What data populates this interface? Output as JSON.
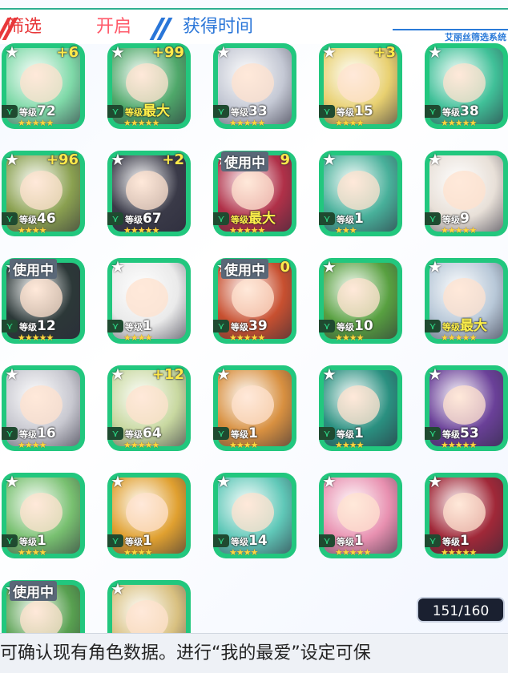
{
  "header": {
    "tabs": [
      {
        "label": "筛选",
        "color": "#e8383a"
      },
      {
        "label": "开启",
        "color": "#ff5a6a"
      },
      {
        "label": "获得时间",
        "color": "#2a76d8"
      }
    ],
    "brand": "艾丽丝筛选系统"
  },
  "cards": [
    {
      "plus": "+6",
      "level_label": "等级",
      "level": "72",
      "stars": 5,
      "in_use": "",
      "theme": "#7fd9a8"
    },
    {
      "plus": "+99",
      "level_label": "等级",
      "level": "最大",
      "stars": 5,
      "in_use": "",
      "theme": "#4fa86a"
    },
    {
      "plus": "",
      "level_label": "等级",
      "level": "33",
      "stars": 5,
      "in_use": "",
      "theme": "#c4c8d4"
    },
    {
      "plus": "+3",
      "level_label": "等级",
      "level": "15",
      "stars": 4,
      "in_use": "",
      "theme": "#e8d070"
    },
    {
      "plus": "",
      "level_label": "等级",
      "level": "38",
      "stars": 5,
      "in_use": "",
      "theme": "#40c098"
    },
    {
      "plus": "+96",
      "level_label": "等级",
      "level": "46",
      "stars": 4,
      "in_use": "",
      "theme": "#8aa050"
    },
    {
      "plus": "+2",
      "level_label": "等级",
      "level": "67",
      "stars": 5,
      "in_use": "",
      "theme": "#3a3a48"
    },
    {
      "plus": "9",
      "level_label": "等级",
      "level": "最大",
      "stars": 5,
      "in_use": "使用中",
      "theme": "#b03048"
    },
    {
      "plus": "",
      "level_label": "等级",
      "level": "1",
      "stars": 3,
      "in_use": "",
      "theme": "#48b09a"
    },
    {
      "plus": "",
      "level_label": "等级",
      "level": "9",
      "stars": 5,
      "in_use": "",
      "theme": "#e8e0d8"
    },
    {
      "plus": "",
      "level_label": "等级",
      "level": "12",
      "stars": 5,
      "in_use": "使用中",
      "theme": "#2c3838"
    },
    {
      "plus": "",
      "level_label": "等级",
      "level": "1",
      "stars": 4,
      "in_use": "",
      "theme": "#eaeaea"
    },
    {
      "plus": "0",
      "level_label": "等级",
      "level": "39",
      "stars": 5,
      "in_use": "使用中",
      "theme": "#c85030"
    },
    {
      "plus": "",
      "level_label": "等级",
      "level": "10",
      "stars": 4,
      "in_use": "",
      "theme": "#58a040"
    },
    {
      "plus": "",
      "level_label": "等级",
      "level": "最大",
      "stars": 5,
      "in_use": "",
      "theme": "#b8c8d8"
    },
    {
      "plus": "",
      "level_label": "等级",
      "level": "16",
      "stars": 4,
      "in_use": "",
      "theme": "#c8c8d0"
    },
    {
      "plus": "+12",
      "level_label": "等级",
      "level": "64",
      "stars": 5,
      "in_use": "",
      "theme": "#c8d8a0"
    },
    {
      "plus": "",
      "level_label": "等级",
      "level": "1",
      "stars": 4,
      "in_use": "",
      "theme": "#d89040"
    },
    {
      "plus": "",
      "level_label": "等级",
      "level": "1",
      "stars": 4,
      "in_use": "",
      "theme": "#2a9080"
    },
    {
      "plus": "",
      "level_label": "等级",
      "level": "53",
      "stars": 5,
      "in_use": "",
      "theme": "#6a4098"
    },
    {
      "plus": "",
      "level_label": "等级",
      "level": "1",
      "stars": 4,
      "in_use": "",
      "theme": "#78c070"
    },
    {
      "plus": "",
      "level_label": "等级",
      "level": "1",
      "stars": 4,
      "in_use": "",
      "theme": "#e0a030"
    },
    {
      "plus": "",
      "level_label": "等级",
      "level": "14",
      "stars": 4,
      "in_use": "",
      "theme": "#60c8b8"
    },
    {
      "plus": "",
      "level_label": "等级",
      "level": "1",
      "stars": 5,
      "in_use": "",
      "theme": "#e890b0"
    },
    {
      "plus": "",
      "level_label": "等级",
      "level": "1",
      "stars": 5,
      "in_use": "",
      "theme": "#a02838"
    },
    {
      "plus": "",
      "level_label": "",
      "level": "",
      "stars": 0,
      "in_use": "使用中",
      "theme": "#58a050"
    },
    {
      "plus": "",
      "level_label": "",
      "level": "",
      "stars": 0,
      "in_use": "",
      "theme": "#d8c080"
    }
  ],
  "counter": "151/160",
  "hint": "可确认现有角色数据。进行“我的最爱”设定可保"
}
